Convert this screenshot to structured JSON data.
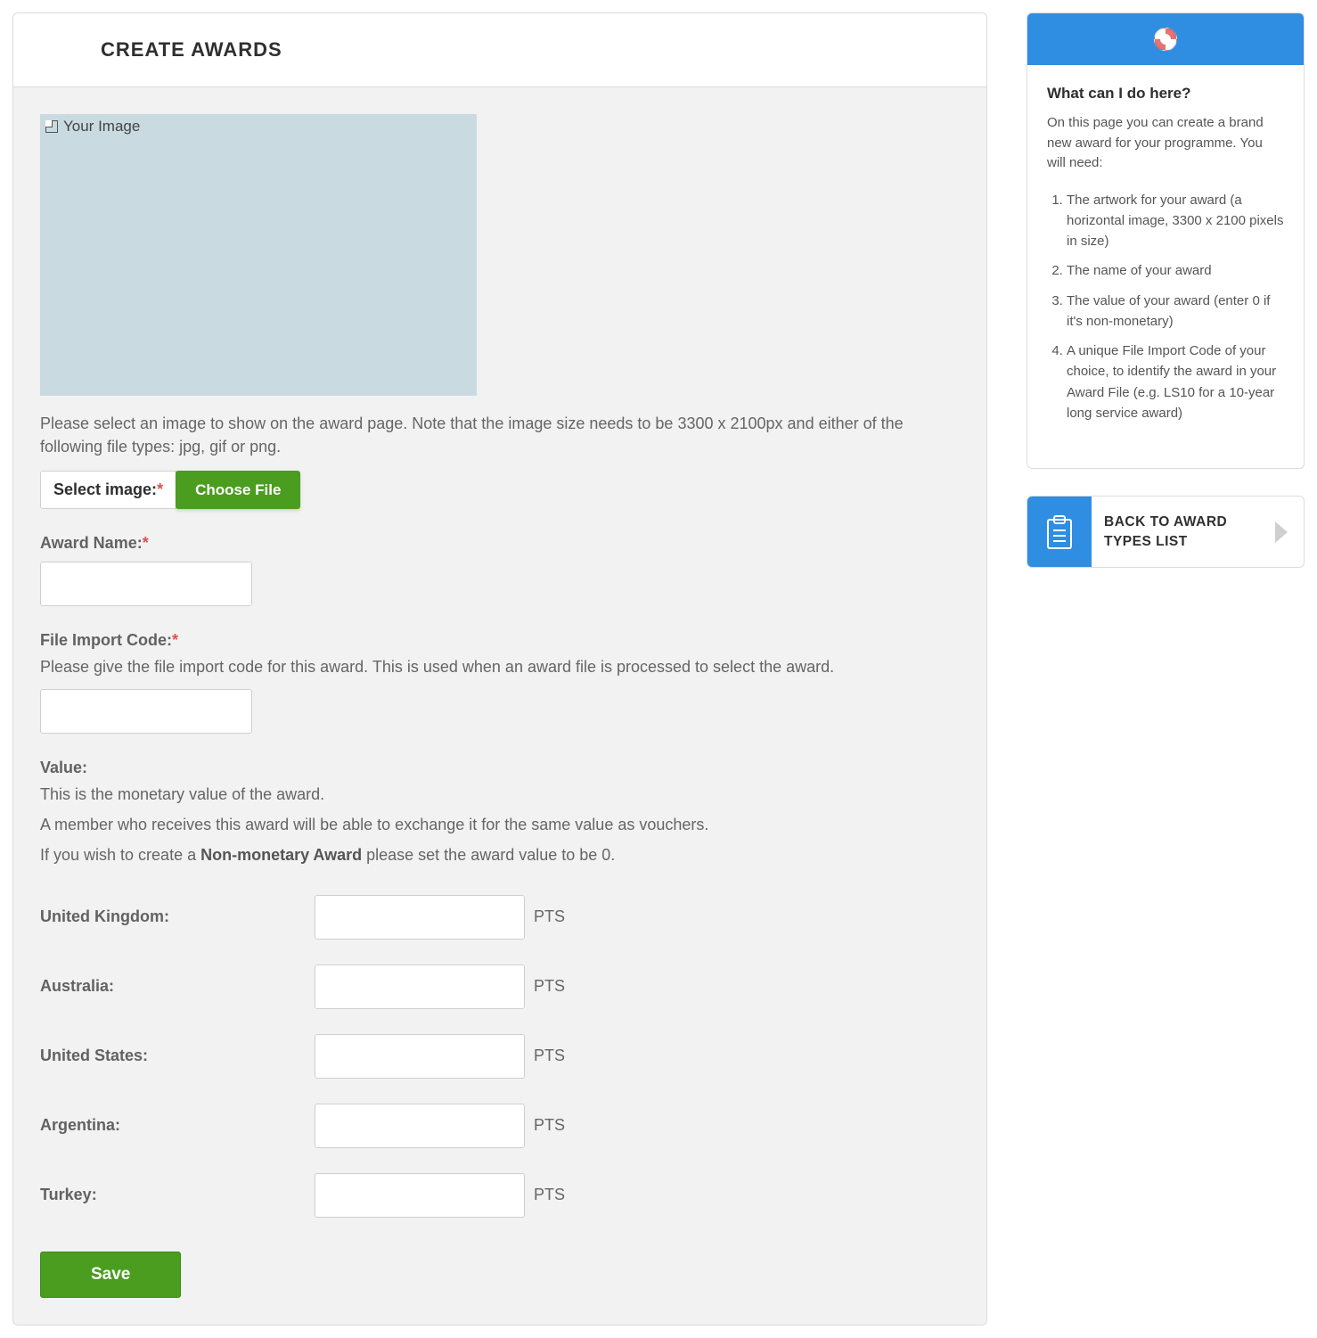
{
  "page": {
    "title": "CREATE AWARDS"
  },
  "preview": {
    "alt": "Your Image"
  },
  "image_section": {
    "hint": "Please select an image to show on the award page. Note that the image size needs to be 3300 x 2100px and either of the following file types: jpg, gif or png.",
    "select_label": "Select image:",
    "choose_button": "Choose File"
  },
  "award_name": {
    "label": "Award Name:",
    "value": ""
  },
  "file_import": {
    "label": "File Import Code:",
    "hint": "Please give the file import code for this award. This is used when an award file is processed to select the award.",
    "value": ""
  },
  "value_section": {
    "label": "Value:",
    "line1": "This is the monetary value of the award.",
    "line2": "A member who receives this award will be able to exchange it for the same value as vouchers.",
    "line3_prefix": "If you wish to create a ",
    "line3_strong": "Non-monetary Award",
    "line3_suffix": " please set the award value to be 0."
  },
  "value_rows": [
    {
      "label": "United Kingdom:",
      "unit": "PTS",
      "value": ""
    },
    {
      "label": "Australia:",
      "unit": "PTS",
      "value": ""
    },
    {
      "label": "United States:",
      "unit": "PTS",
      "value": ""
    },
    {
      "label": "Argentina:",
      "unit": "PTS",
      "value": ""
    },
    {
      "label": "Turkey:",
      "unit": "PTS",
      "value": ""
    }
  ],
  "buttons": {
    "save": "Save"
  },
  "help": {
    "title": "What can I do here?",
    "intro": "On this page you can create a brand new award for your programme. You will need:",
    "items": [
      "The artwork for your award (a horizontal image, 3300 x 2100 pixels in size)",
      "The name of your award",
      "The value of your award (enter 0 if it's non-monetary)",
      "A unique File Import Code of your choice, to identify the award in your Award File (e.g. LS10 for a 10-year long service award)"
    ]
  },
  "back_link": {
    "label": "BACK TO AWARD TYPES LIST"
  }
}
